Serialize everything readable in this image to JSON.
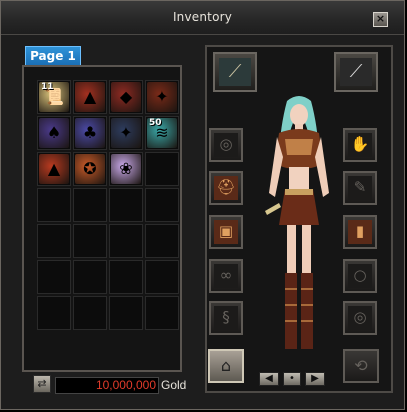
{
  "window": {
    "title": "Inventory",
    "close_label": "×"
  },
  "tabs": [
    {
      "label": "Page 1"
    }
  ],
  "inventory": {
    "items": [
      {
        "name": "scroll-item",
        "qty": "11",
        "color": "#d9c27a",
        "glyph": "📜"
      },
      {
        "name": "red-armor-item",
        "qty": "",
        "color": "#a33020",
        "glyph": "▲"
      },
      {
        "name": "red-hat-item",
        "qty": "",
        "color": "#8e2a22",
        "glyph": "◆"
      },
      {
        "name": "broom-item",
        "qty": "",
        "color": "#7a2a18",
        "glyph": "✦"
      },
      {
        "name": "purple-costume-item",
        "qty": "",
        "color": "#4a3a8a",
        "glyph": "♠"
      },
      {
        "name": "purple-hood-item",
        "qty": "",
        "color": "#4b4aa6",
        "glyph": "♣"
      },
      {
        "name": "broom-item-2",
        "qty": "",
        "color": "#2d3c5e",
        "glyph": "✦"
      },
      {
        "name": "teal-scroll-item",
        "qty": "50",
        "color": "#3aa6a6",
        "glyph": "≋"
      },
      {
        "name": "red-outfit-item",
        "qty": "",
        "color": "#b83a20",
        "glyph": "▲"
      },
      {
        "name": "fox-mask-item",
        "qty": "",
        "color": "#c85a28",
        "glyph": "✪"
      },
      {
        "name": "fairy-doll-item",
        "qty": "",
        "color": "#c8a8e8",
        "glyph": "❀"
      }
    ],
    "empty_count": 17
  },
  "currency": {
    "gold_value": "10,000,000",
    "gold_label": "Gold"
  },
  "equipment": {
    "weapon_left": {
      "name": "spear-icon",
      "glyph": "⟋"
    },
    "weapon_right": {
      "name": "blade-icon",
      "glyph": "⟋"
    },
    "left_slots": [
      {
        "name": "ring-icon",
        "glyph": "◎",
        "filled": false
      },
      {
        "name": "helmet-icon",
        "glyph": "⛑",
        "filled": true
      },
      {
        "name": "armor-icon",
        "glyph": "▣",
        "filled": true
      },
      {
        "name": "bracelet-icon",
        "glyph": "∞",
        "filled": false
      },
      {
        "name": "earring-icon",
        "glyph": "§",
        "filled": false
      }
    ],
    "right_slots": [
      {
        "name": "gloves-icon",
        "glyph": "✋",
        "filled": false
      },
      {
        "name": "weapon-slot-icon",
        "glyph": "✎",
        "filled": false
      },
      {
        "name": "boots-icon",
        "glyph": "▮",
        "filled": true
      },
      {
        "name": "necklace-icon",
        "glyph": "○",
        "filled": false
      },
      {
        "name": "ring-2-icon",
        "glyph": "◎",
        "filled": false
      }
    ]
  },
  "colors": {
    "gold_text": "#e23b2a",
    "tab_blue": "#2f93d8",
    "panel_border": "#5a5550"
  }
}
